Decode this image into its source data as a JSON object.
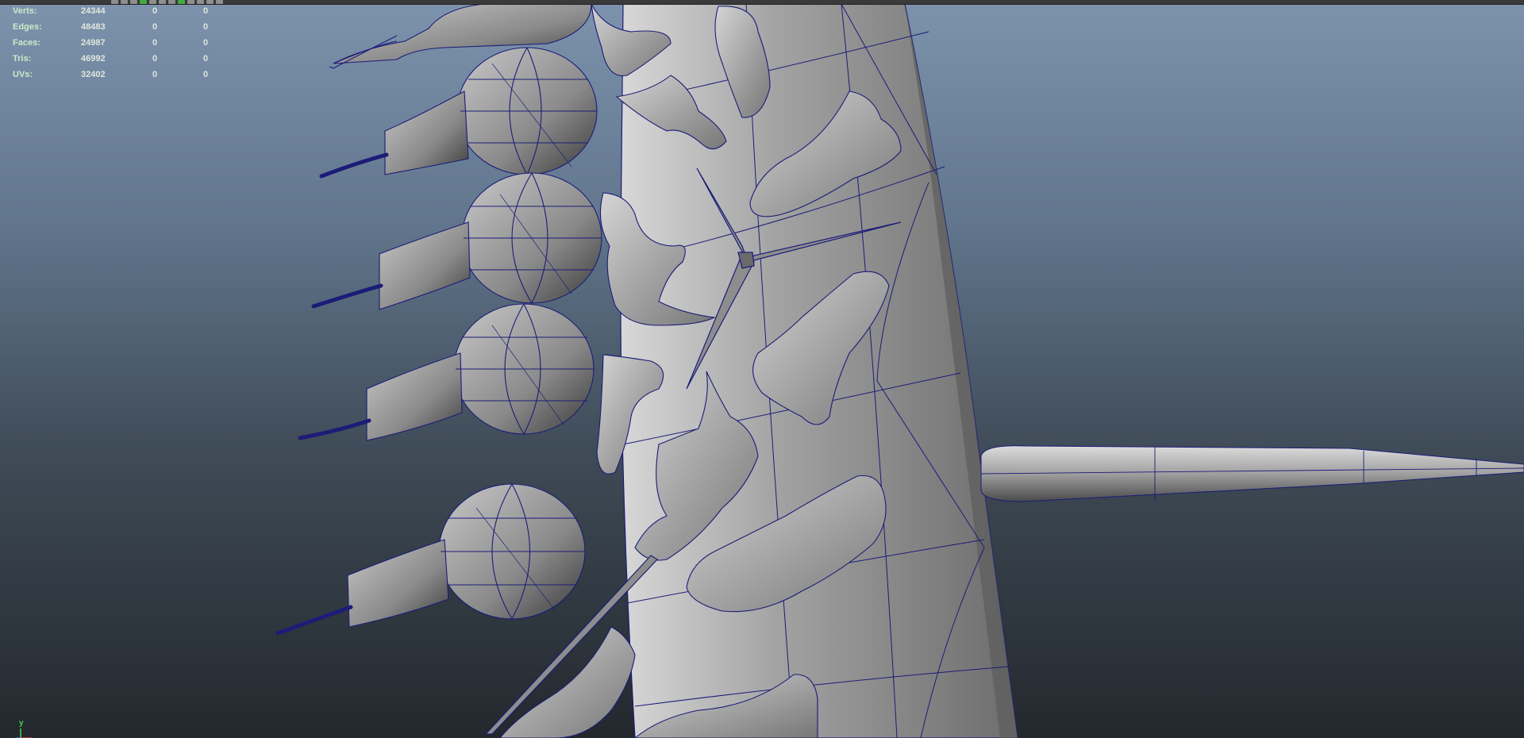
{
  "viewport": {
    "name": "Maya perspective viewport",
    "background_top": "#7d93ad",
    "background_bottom": "#23282d",
    "wire_color": "#1c1c78",
    "mesh_color": "#9e9e9e"
  },
  "toolbar": {
    "icons": [
      "select-icon",
      "lasso-icon",
      "paint-icon",
      "camera-icon",
      "grid-icon",
      "shading-icon",
      "wireframe-icon",
      "isolate-icon"
    ]
  },
  "hud": {
    "rows": [
      {
        "label": "Verts:",
        "v1": "24344",
        "v2": "0",
        "v3": "0"
      },
      {
        "label": "Edges:",
        "v1": "48483",
        "v2": "0",
        "v3": "0"
      },
      {
        "label": "Faces:",
        "v1": "24987",
        "v2": "0",
        "v3": "0"
      },
      {
        "label": "Tris:",
        "v1": "46992",
        "v2": "0",
        "v3": "0"
      },
      {
        "label": "UVs:",
        "v1": "32402",
        "v2": "0",
        "v3": "0"
      }
    ]
  },
  "axis": {
    "y_label": "y",
    "y_color": "#42d742",
    "x_color": "#d83b3b",
    "z_color": "#3b6bd8"
  }
}
